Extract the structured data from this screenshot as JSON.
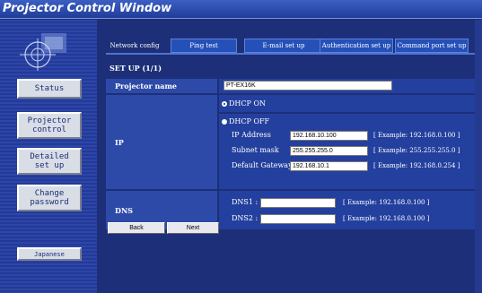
{
  "window": {
    "title": "Projector Control Window"
  },
  "sidebar": {
    "buttons": [
      {
        "label": "Status"
      },
      {
        "label": "Projector\ncontrol"
      },
      {
        "label": "Detailed\nset up"
      },
      {
        "label": "Change\npassword"
      },
      {
        "label": "Japanese"
      }
    ]
  },
  "tabs": [
    {
      "label": "Network config"
    },
    {
      "label": "Ping test"
    },
    {
      "label": "E-mail set up"
    },
    {
      "label": "Authentication set up"
    },
    {
      "label": "Command port set up"
    }
  ],
  "setup": {
    "title": "SET UP (1/1)"
  },
  "form": {
    "projector_name": {
      "label": "Projector name",
      "value": "PT-EX16K"
    },
    "ip": {
      "label": "IP",
      "dhcp_on": "DHCP ON",
      "dhcp_off": "DHCP OFF",
      "ip_address": {
        "label": "IP Address",
        "value": "192.168.10.100",
        "example": "[ Example: 192.168.0.100 ]"
      },
      "subnet_mask": {
        "label": "Subnet mask",
        "value": "255.255.255.0",
        "example": "[ Example: 255.255.255.0 ]"
      },
      "default_gateway": {
        "label": "Default Gateway",
        "value": "192.168.10.1",
        "example": "[ Example: 192.168.0.254 ]"
      }
    },
    "dns": {
      "label": "DNS",
      "dns1": {
        "label": "DNS1 :",
        "value": "",
        "example": "[ Example: 192.168.0.100 ]"
      },
      "dns2": {
        "label": "DNS2 :",
        "value": "",
        "example": "[ Example: 192.168.0.100 ]"
      }
    }
  },
  "actions": {
    "back": "Back",
    "next": "Next"
  }
}
